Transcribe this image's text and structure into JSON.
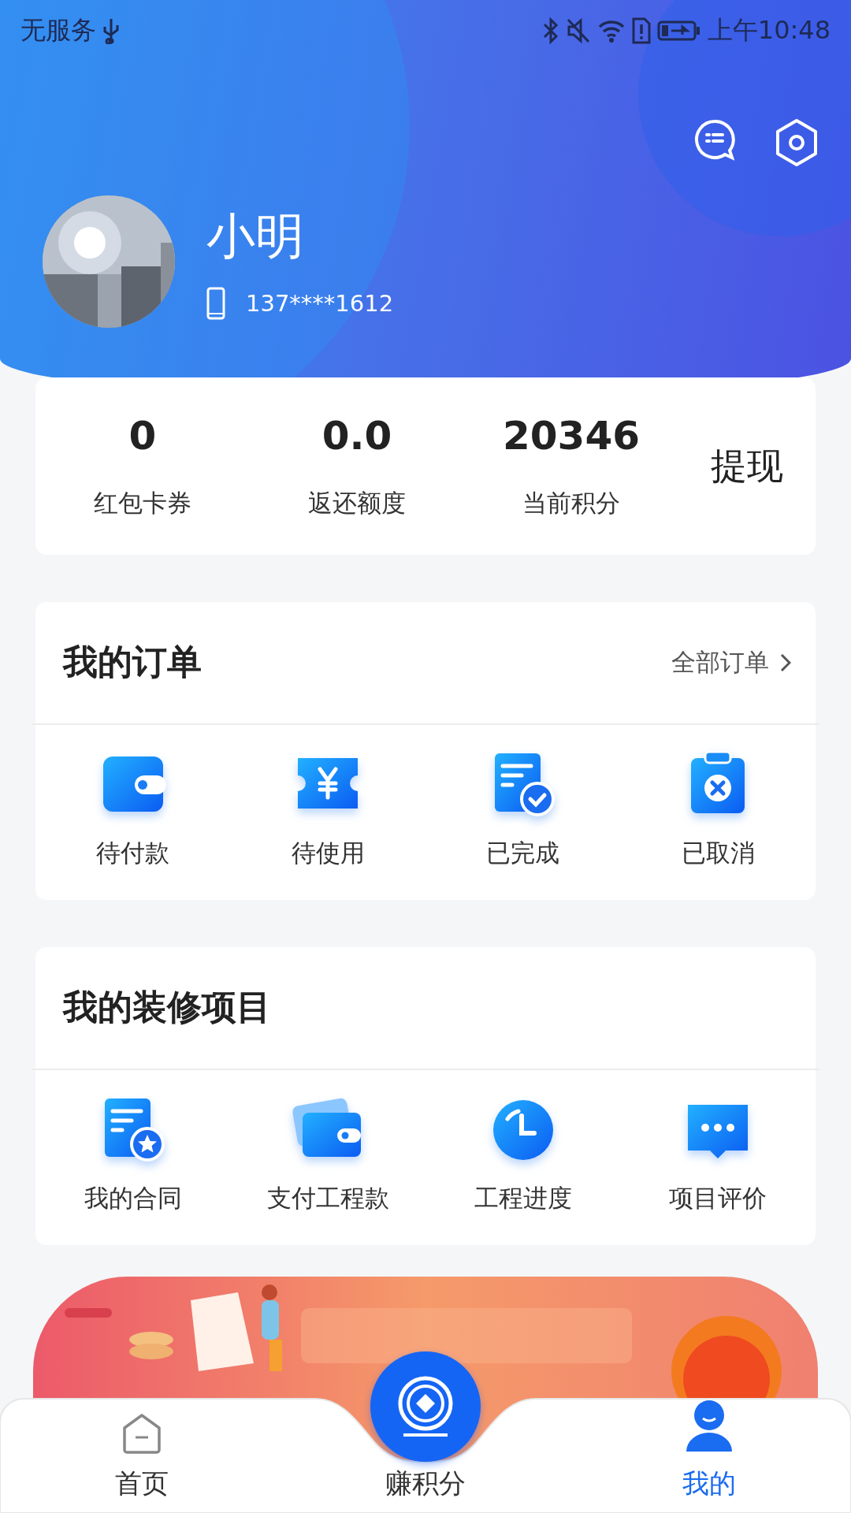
{
  "status_bar": {
    "carrier": "无服务",
    "time": "上午10:48"
  },
  "profile": {
    "name": "小明",
    "phone": "137****1612"
  },
  "stats": {
    "items": [
      {
        "value": "0",
        "label": "红包卡券"
      },
      {
        "value": "0.0",
        "label": "返还额度"
      },
      {
        "value": "20346",
        "label": "当前积分"
      }
    ],
    "action": "提现"
  },
  "orders": {
    "title": "我的订单",
    "link": "全部订单",
    "items": [
      {
        "kind": "wallet",
        "label": "待付款"
      },
      {
        "kind": "ticket",
        "label": "待使用"
      },
      {
        "kind": "done",
        "label": "已完成"
      },
      {
        "kind": "cancel",
        "label": "已取消"
      }
    ]
  },
  "projects": {
    "title": "我的装修项目",
    "items": [
      {
        "kind": "contract",
        "label": "我的合同"
      },
      {
        "kind": "pay",
        "label": "支付工程款"
      },
      {
        "kind": "progress",
        "label": "工程进度"
      },
      {
        "kind": "review",
        "label": "项目评价"
      }
    ]
  },
  "bottom_nav": [
    {
      "kind": "home",
      "label": "首页",
      "selected": false
    },
    {
      "kind": "points",
      "label": "赚积分",
      "selected": false
    },
    {
      "kind": "me",
      "label": "我的",
      "selected": true
    }
  ]
}
